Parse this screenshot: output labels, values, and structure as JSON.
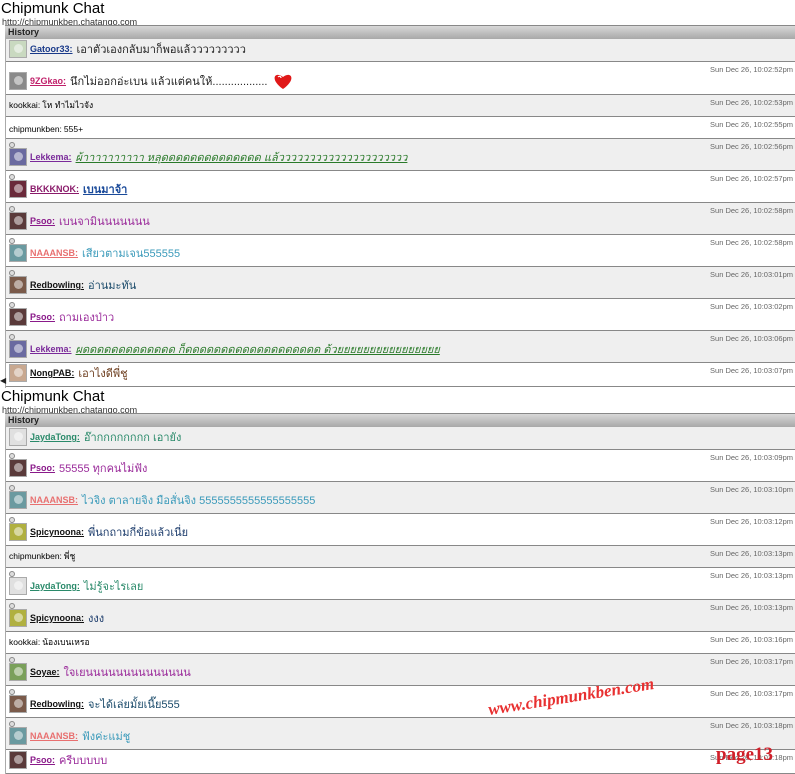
{
  "panels": [
    {
      "title": "Chipmunk Chat",
      "url": "http://chipmunkben.chatango.com",
      "history_label": "History",
      "rows": [
        {
          "user": "Gatoor33:",
          "text": "เอาตัวเองกลับมาก็พอแล้ววววววววว",
          "ts": "",
          "color": "#1a3a8a",
          "text_color": "#222",
          "style": "",
          "plain": false,
          "height": 23,
          "alt": true,
          "first": true,
          "avatar_color": "#c9d9c0"
        },
        {
          "user": "9ZGkao:",
          "text": "นึกไม่ออกอ่ะเบน  แล้วแต่คนให้..................",
          "ts": "Sun Dec 26, 10:02:52pm",
          "color": "#c0206a",
          "text_color": "#222",
          "style": "",
          "plain": false,
          "height": 33,
          "alt": false,
          "heart": true,
          "avatar_color": "#8a8a8a"
        },
        {
          "user": "kookkai:",
          "text": "โห ทำไมไวจัง",
          "ts": "Sun Dec 26, 10:02:53pm",
          "color": "#000",
          "text_color": "#000",
          "style": "",
          "plain": true,
          "height": 22,
          "alt": true
        },
        {
          "user": "chipmunkben:",
          "text": "555+",
          "ts": "Sun Dec 26, 10:02:55pm",
          "color": "#000",
          "text_color": "#000",
          "style": "",
          "plain": true,
          "height": 22,
          "alt": false
        },
        {
          "user": "Lekkema:",
          "text": "ผ้าาาาาาาาาา หลุดดดดดดดดดดดดดด แล้ววววววววววววววววววววว",
          "ts": "Sun Dec 26, 10:02:56pm",
          "color": "#7a2a9a",
          "text_color": "#2a7a2a",
          "style": "iu",
          "plain": false,
          "height": 32,
          "alt": true,
          "dot": true,
          "avatar_color": "#6a6aa0"
        },
        {
          "user": "BKKKNOK:",
          "text": "เบนมาจ้า",
          "ts": "Sun Dec 26, 10:02:57pm",
          "color": "#8a1a6a",
          "text_color": "#1a4a9a",
          "style": "bu",
          "plain": false,
          "height": 32,
          "alt": false,
          "dot": true,
          "avatar_color": "#6a2a3a"
        },
        {
          "user": "Psoo:",
          "text": "เบนจามินนนนนนน",
          "ts": "Sun Dec 26, 10:02:58pm",
          "color": "#8a1a8a",
          "text_color": "#9a2a9a",
          "style": "",
          "plain": false,
          "height": 32,
          "alt": true,
          "dot": true,
          "avatar_color": "#5a3a3a"
        },
        {
          "user": "NAAANSB:",
          "text": "เสียวตามเจน555555",
          "ts": "Sun Dec 26, 10:02:58pm",
          "color": "#e87070",
          "text_color": "#3a9aba",
          "style": "",
          "plain": false,
          "height": 32,
          "alt": false,
          "dot": true,
          "avatar_color": "#6a9aa0"
        },
        {
          "user": "Redbowling:",
          "text": "อ่านมะทัน",
          "ts": "Sun Dec 26, 10:03:01pm",
          "color": "#111",
          "text_color": "#1a4a6a",
          "style": "",
          "plain": false,
          "height": 32,
          "alt": true,
          "dot": true,
          "avatar_color": "#7a5a4a"
        },
        {
          "user": "Psoo:",
          "text": "ถามเองป่าว",
          "ts": "Sun Dec 26, 10:03:02pm",
          "color": "#8a1a8a",
          "text_color": "#9a2a9a",
          "style": "",
          "plain": false,
          "height": 32,
          "alt": false,
          "dot": true,
          "avatar_color": "#5a3a3a"
        },
        {
          "user": "Lekkema:",
          "text": "ผดดดดดดดดดดดดด ก็ดดดดดดดดดดดดดดดดดดด ด้วยยยยยยยยยยยยยยยย",
          "ts": "Sun Dec 26, 10:03:06pm",
          "color": "#7a2a9a",
          "text_color": "#2a7a2a",
          "style": "iu",
          "plain": false,
          "height": 32,
          "alt": true,
          "dot": true,
          "avatar_color": "#6a6aa0"
        },
        {
          "user": "NongPAB:",
          "text": "เอาไงดีพี่ชู",
          "ts": "Sun Dec 26, 10:03:07pm",
          "color": "#111",
          "text_color": "#6a3a1a",
          "style": "",
          "plain": false,
          "height": 24,
          "alt": false,
          "dot": true,
          "avatar_color": "#c8a890"
        }
      ]
    },
    {
      "title": "Chipmunk Chat",
      "url": "http://chipmunkben.chatango.com",
      "history_label": "History",
      "rows": [
        {
          "user": "JaydaTong:",
          "text": "อ๊ากกกกกกกก เอายัง",
          "ts": "",
          "color": "#2a8a6a",
          "text_color": "#2a8a6a",
          "style": "",
          "plain": false,
          "height": 23,
          "alt": true,
          "first": true,
          "avatar_color": "#e0e0e0"
        },
        {
          "user": "Psoo:",
          "text": "55555 ทุกคนไม่ฟัง",
          "ts": "Sun Dec 26, 10:03:09pm",
          "color": "#8a1a8a",
          "text_color": "#9a2a9a",
          "style": "",
          "plain": false,
          "height": 32,
          "alt": false,
          "dot": true,
          "avatar_color": "#5a3a3a"
        },
        {
          "user": "NAAANSB:",
          "text": "ไวจิง ตาลายจิง มือสั่นจิง 5555555555555555555",
          "ts": "Sun Dec 26, 10:03:10pm",
          "color": "#e87070",
          "text_color": "#3a9aba",
          "style": "",
          "plain": false,
          "height": 32,
          "alt": true,
          "dot": true,
          "avatar_color": "#6a9aa0"
        },
        {
          "user": "Spicynoona:",
          "text": "พี่นกถามกี่ข้อแล้วเนี่ย",
          "ts": "Sun Dec 26, 10:03:12pm",
          "color": "#111",
          "text_color": "#1a3a6a",
          "style": "",
          "plain": false,
          "height": 32,
          "alt": false,
          "dot": true,
          "avatar_color": "#b0b040"
        },
        {
          "user": "chipmunkben:",
          "text": "พี่ชู",
          "ts": "Sun Dec 26, 10:03:13pm",
          "color": "#000",
          "text_color": "#000",
          "style": "",
          "plain": true,
          "height": 22,
          "alt": true
        },
        {
          "user": "JaydaTong:",
          "text": "ไม่รู้จะไรเลย",
          "ts": "Sun Dec 26, 10:03:13pm",
          "color": "#2a8a6a",
          "text_color": "#2a8a6a",
          "style": "",
          "plain": false,
          "height": 32,
          "alt": false,
          "dot": true,
          "avatar_color": "#e0e0e0"
        },
        {
          "user": "Spicynoona:",
          "text": "งงง",
          "ts": "Sun Dec 26, 10:03:13pm",
          "color": "#111",
          "text_color": "#1a3a6a",
          "style": "",
          "plain": false,
          "height": 32,
          "alt": true,
          "dot": true,
          "avatar_color": "#b0b040"
        },
        {
          "user": "kookkai:",
          "text": "น้องเบนเหรอ",
          "ts": "Sun Dec 26, 10:03:16pm",
          "color": "#000",
          "text_color": "#000",
          "style": "",
          "plain": true,
          "height": 22,
          "alt": false
        },
        {
          "user": "Soyae:",
          "text": "ใจเยนนนนนนนนนนนนนน",
          "ts": "Sun Dec 26, 10:03:17pm",
          "color": "#111",
          "text_color": "#9a2a9a",
          "style": "",
          "plain": false,
          "height": 32,
          "alt": true,
          "dot": true,
          "avatar_color": "#7aa05a"
        },
        {
          "user": "Redbowling:",
          "text": "จะได้เล่ยมั้ยเนี๊ย555",
          "ts": "Sun Dec 26, 10:03:17pm",
          "color": "#111",
          "text_color": "#1a4a6a",
          "style": "",
          "plain": false,
          "height": 32,
          "alt": false,
          "dot": true,
          "avatar_color": "#7a5a4a"
        },
        {
          "user": "NAAANSB:",
          "text": "ฟังค่ะแม่ชู",
          "ts": "Sun Dec 26, 10:03:18pm",
          "color": "#e87070",
          "text_color": "#3a9aba",
          "style": "",
          "plain": false,
          "height": 32,
          "alt": true,
          "dot": true,
          "avatar_color": "#6a9aa0"
        },
        {
          "user": "Psoo:",
          "text": "ครีบบบบบ",
          "ts": "Sun Dec 26, 10:03:18pm",
          "color": "#8a1a8a",
          "text_color": "#9a2a9a",
          "style": "",
          "plain": false,
          "height": 24,
          "alt": false,
          "dot": true,
          "avatar_color": "#5a3a3a"
        }
      ]
    }
  ],
  "watermark": "www.chipmunkben.com",
  "page_label": "page13"
}
